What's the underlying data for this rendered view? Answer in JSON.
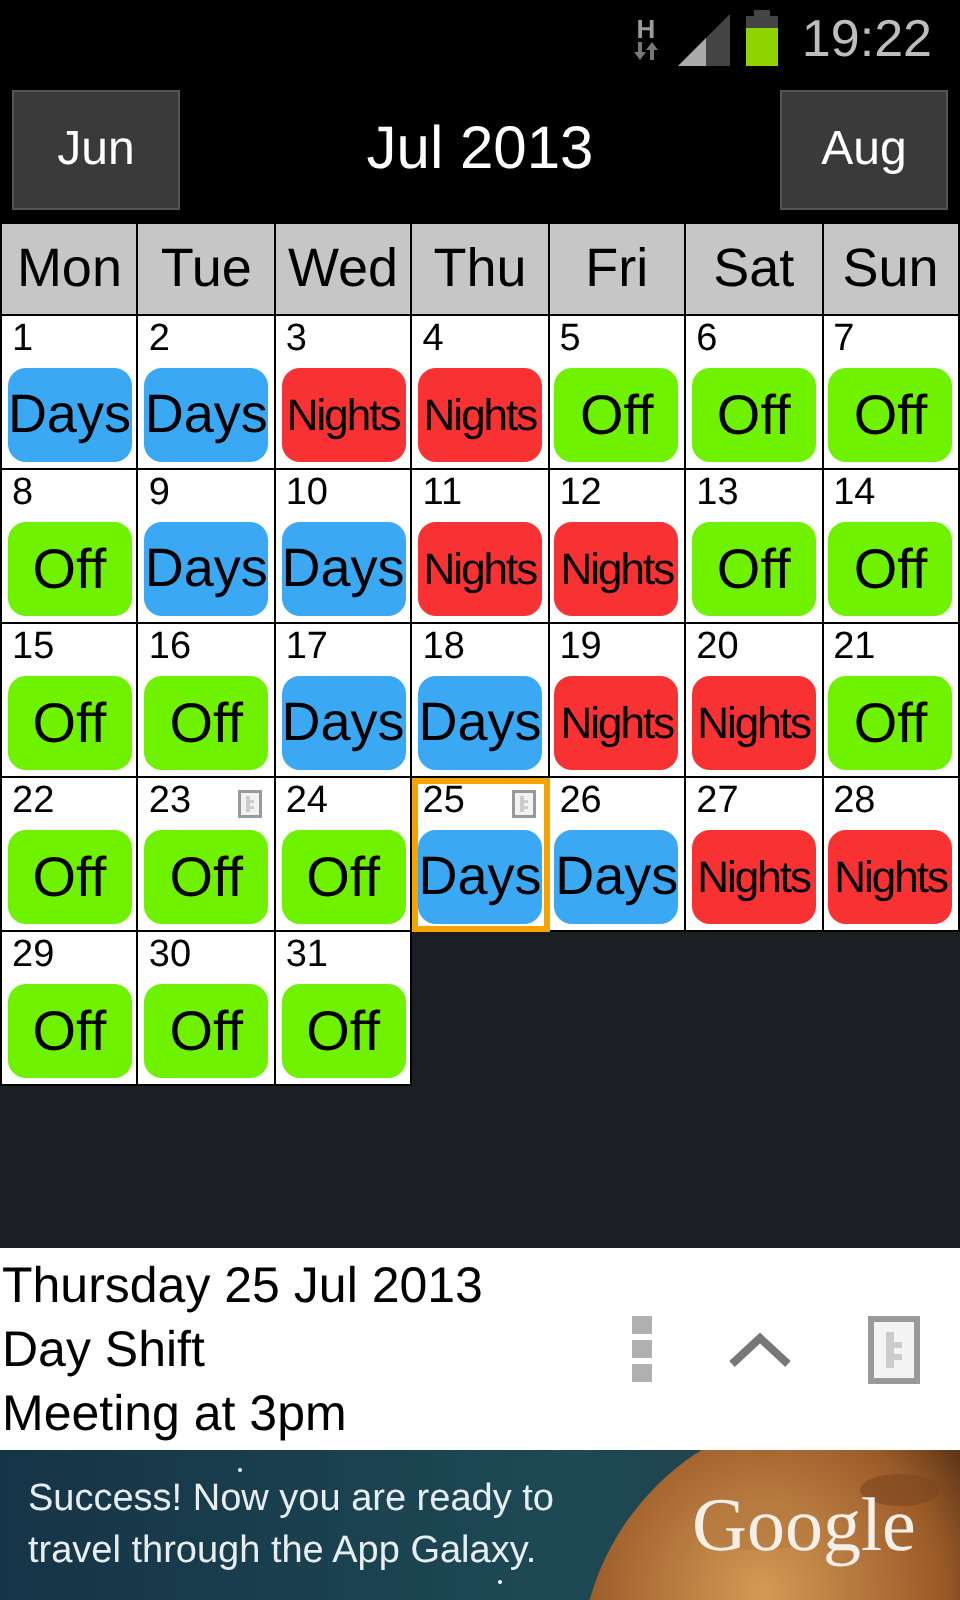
{
  "status_bar": {
    "network": "H",
    "time": "19:22"
  },
  "header": {
    "prev_button": "Jun",
    "title": "Jul 2013",
    "next_button": "Aug"
  },
  "weekdays": [
    "Mon",
    "Tue",
    "Wed",
    "Thu",
    "Fri",
    "Sat",
    "Sun"
  ],
  "days": [
    {
      "day": "1",
      "kind": "days",
      "label": "Days",
      "note": false,
      "selected": false
    },
    {
      "day": "2",
      "kind": "days",
      "label": "Days",
      "note": false,
      "selected": false
    },
    {
      "day": "3",
      "kind": "nights",
      "label": "Nights",
      "note": false,
      "selected": false
    },
    {
      "day": "4",
      "kind": "nights",
      "label": "Nights",
      "note": false,
      "selected": false
    },
    {
      "day": "5",
      "kind": "off",
      "label": "Off",
      "note": false,
      "selected": false
    },
    {
      "day": "6",
      "kind": "off",
      "label": "Off",
      "note": false,
      "selected": false
    },
    {
      "day": "7",
      "kind": "off",
      "label": "Off",
      "note": false,
      "selected": false
    },
    {
      "day": "8",
      "kind": "off",
      "label": "Off",
      "note": false,
      "selected": false
    },
    {
      "day": "9",
      "kind": "days",
      "label": "Days",
      "note": false,
      "selected": false
    },
    {
      "day": "10",
      "kind": "days",
      "label": "Days",
      "note": false,
      "selected": false
    },
    {
      "day": "11",
      "kind": "nights",
      "label": "Nights",
      "note": false,
      "selected": false
    },
    {
      "day": "12",
      "kind": "nights",
      "label": "Nights",
      "note": false,
      "selected": false
    },
    {
      "day": "13",
      "kind": "off",
      "label": "Off",
      "note": false,
      "selected": false
    },
    {
      "day": "14",
      "kind": "off",
      "label": "Off",
      "note": false,
      "selected": false
    },
    {
      "day": "15",
      "kind": "off",
      "label": "Off",
      "note": false,
      "selected": false
    },
    {
      "day": "16",
      "kind": "off",
      "label": "Off",
      "note": false,
      "selected": false
    },
    {
      "day": "17",
      "kind": "days",
      "label": "Days",
      "note": false,
      "selected": false
    },
    {
      "day": "18",
      "kind": "days",
      "label": "Days",
      "note": false,
      "selected": false
    },
    {
      "day": "19",
      "kind": "nights",
      "label": "Nights",
      "note": false,
      "selected": false
    },
    {
      "day": "20",
      "kind": "nights",
      "label": "Nights",
      "note": false,
      "selected": false
    },
    {
      "day": "21",
      "kind": "off",
      "label": "Off",
      "note": false,
      "selected": false
    },
    {
      "day": "22",
      "kind": "off",
      "label": "Off",
      "note": false,
      "selected": false
    },
    {
      "day": "23",
      "kind": "off",
      "label": "Off",
      "note": true,
      "selected": false
    },
    {
      "day": "24",
      "kind": "off",
      "label": "Off",
      "note": false,
      "selected": false
    },
    {
      "day": "25",
      "kind": "days",
      "label": "Days",
      "note": true,
      "selected": true
    },
    {
      "day": "26",
      "kind": "days",
      "label": "Days",
      "note": false,
      "selected": false
    },
    {
      "day": "27",
      "kind": "nights",
      "label": "Nights",
      "note": false,
      "selected": false
    },
    {
      "day": "28",
      "kind": "nights",
      "label": "Nights",
      "note": false,
      "selected": false
    },
    {
      "day": "29",
      "kind": "off",
      "label": "Off",
      "note": false,
      "selected": false
    },
    {
      "day": "30",
      "kind": "off",
      "label": "Off",
      "note": false,
      "selected": false
    },
    {
      "day": "31",
      "kind": "off",
      "label": "Off",
      "note": false,
      "selected": false
    }
  ],
  "details": {
    "date": "Thursday 25 Jul 2013",
    "shift": "Day Shift",
    "note": "Meeting at 3pm"
  },
  "ad": {
    "text": "Success! Now you are ready to travel through the App Galaxy.",
    "brand": "Google"
  }
}
